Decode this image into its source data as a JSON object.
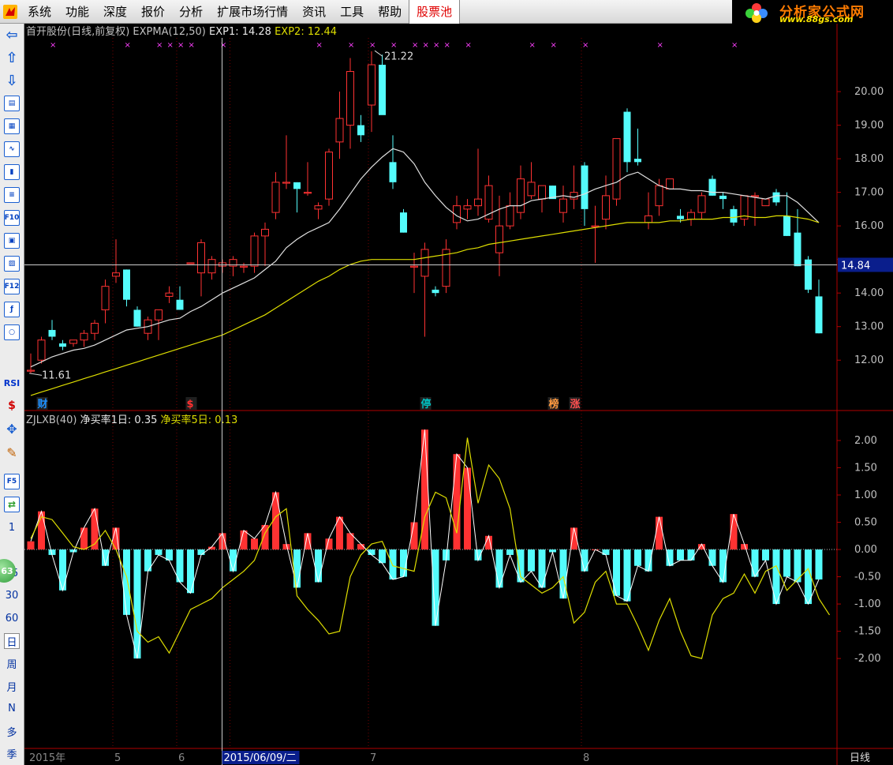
{
  "menu": {
    "items": [
      "系统",
      "功能",
      "深度",
      "报价",
      "分析",
      "扩展市场行情",
      "资讯",
      "工具",
      "帮助",
      "股票池"
    ],
    "highlight_index": 9
  },
  "brand": {
    "title": "分析家公式网",
    "url": "www.88gs.com"
  },
  "toolbar": {
    "icons": [
      "arrow-left-icon",
      "arrow-up-icon",
      "arrow-down-icon",
      "quote-list-icon",
      "grid-icon",
      "line-chart-icon",
      "candle-icon",
      "table-icon",
      "f10-icon",
      "report-icon",
      "finance-icon",
      "f12-icon",
      "formula-icon",
      "refresh-circle-icon"
    ],
    "labels": [
      "RSI",
      "$"
    ],
    "periods": [
      "1",
      "15",
      "30",
      "60",
      "日",
      "周",
      "月",
      "N",
      "多",
      "季"
    ],
    "badge": "63",
    "extra_buttons": [
      "F5"
    ]
  },
  "main_panel": {
    "stock": "首开股份(日线,前复权)",
    "indicator": "EXPMA(12,50)",
    "exp1_label": "EXP1:",
    "exp1_value": "14.28",
    "exp2_label": "EXP2:",
    "exp2_value": "12.44",
    "y_ticks": [
      20,
      19,
      18,
      17,
      16,
      15,
      14,
      13,
      12
    ],
    "y_tick_labels": [
      "20.00",
      "19.00",
      "18.00",
      "17.00",
      "16.00",
      "",
      "14.00",
      "13.00",
      "12.00"
    ],
    "y_range": [
      10.9,
      21.6
    ],
    "crosshair_price": "14.84",
    "high_label": "21.22",
    "low_label": "11.61",
    "event_marks": [
      {
        "index": 1,
        "text": "财",
        "color": "#1e90ff"
      },
      {
        "index": 15,
        "text": "$",
        "color": "#ff3030"
      },
      {
        "index": 37,
        "text": "停",
        "color": "#00c0c0"
      },
      {
        "index": 49,
        "text": "榜",
        "color": "#ff9a40"
      },
      {
        "index": 51,
        "text": "涨",
        "color": "#ff5050"
      }
    ],
    "top_marks": [
      2,
      9,
      12,
      13,
      14,
      15,
      18,
      27,
      30,
      32,
      34,
      36,
      37,
      38,
      39,
      41,
      47,
      49,
      52,
      59,
      66
    ]
  },
  "sub_panel": {
    "indicator": "ZJLXB(40)",
    "line1_label": "净买率1日:",
    "line1_value": "0.35",
    "line2_label": "净买率5日:",
    "line2_value": "0.13",
    "y_ticks": [
      2,
      1.5,
      1,
      0.5,
      0,
      -0.5,
      -1,
      -1.5,
      -2
    ],
    "y_tick_labels": [
      "2.00",
      "1.50",
      "1.00",
      "0.50",
      "0.00",
      "-0.50",
      "-1.00",
      "-1.50",
      "-2.00"
    ],
    "y_range": [
      -3.65,
      2.55
    ]
  },
  "x_axis": {
    "labels": [
      {
        "index": 0,
        "text": "2015年"
      },
      {
        "index": 8,
        "text": "5"
      },
      {
        "index": 14,
        "text": "6"
      },
      {
        "index": 19,
        "text": "2015/06/09/二",
        "highlight": true
      },
      {
        "index": 32,
        "text": "7"
      },
      {
        "index": 52,
        "text": "8"
      }
    ],
    "period": "日线"
  },
  "crosshair_index": 18,
  "colors": {
    "up": "#ff3232",
    "down": "#54fcfc",
    "exp1": "#e0e0e0",
    "exp2": "#dede00",
    "axis": "#b00000",
    "text": "#c0c0c0"
  },
  "chart_data": {
    "type": "candlestick",
    "candles": [
      [
        11.7,
        11.6,
        12.2,
        11.7
      ],
      [
        12.0,
        11.9,
        12.7,
        12.6
      ],
      [
        12.9,
        12.6,
        13.2,
        12.7
      ],
      [
        12.5,
        12.3,
        12.6,
        12.4
      ],
      [
        12.5,
        12.4,
        12.6,
        12.6
      ],
      [
        12.6,
        12.4,
        12.9,
        12.8
      ],
      [
        12.8,
        12.6,
        13.2,
        13.1
      ],
      [
        13.5,
        13.1,
        14.4,
        14.2
      ],
      [
        14.5,
        14.3,
        15.6,
        14.6
      ],
      [
        14.7,
        13.6,
        14.7,
        13.8
      ],
      [
        13.5,
        13.0,
        13.6,
        13.0
      ],
      [
        12.8,
        12.6,
        13.3,
        13.2
      ],
      [
        13.2,
        12.6,
        13.3,
        13.5
      ],
      [
        13.9,
        13.7,
        14.2,
        14.0
      ],
      [
        13.8,
        13.5,
        14.2,
        13.5
      ],
      [
        14.9,
        14.9,
        14.9,
        14.9
      ],
      [
        14.6,
        13.9,
        15.6,
        15.5
      ],
      [
        14.6,
        14.4,
        15.1,
        15.0
      ],
      [
        14.8,
        14.6,
        15.0,
        14.9
      ],
      [
        14.8,
        14.5,
        15.1,
        15.0
      ],
      [
        14.8,
        14.6,
        14.9,
        14.8
      ],
      [
        14.8,
        14.6,
        15.8,
        15.7
      ],
      [
        15.7,
        14.8,
        16.1,
        15.9
      ],
      [
        16.4,
        16.2,
        17.6,
        17.3
      ],
      [
        17.3,
        17.1,
        18.7,
        17.3
      ],
      [
        17.3,
        16.4,
        17.3,
        17.1
      ],
      [
        17.0,
        16.9,
        17.9,
        17.0
      ],
      [
        16.5,
        16.2,
        16.7,
        16.6
      ],
      [
        16.8,
        16.6,
        18.3,
        18.2
      ],
      [
        18.5,
        18.0,
        20.0,
        19.2
      ],
      [
        19.0,
        18.3,
        21.0,
        20.6
      ],
      [
        19.0,
        18.5,
        19.3,
        18.7
      ],
      [
        19.6,
        18.8,
        21.2,
        20.8
      ],
      [
        20.8,
        19.8,
        21.1,
        19.3
      ],
      [
        17.9,
        17.1,
        18.7,
        17.3
      ],
      [
        16.4,
        15.8,
        16.5,
        15.8
      ],
      [
        14.8,
        14.0,
        15.2,
        14.8
      ],
      [
        14.5,
        12.7,
        15.5,
        15.3
      ],
      [
        14.1,
        13.9,
        14.2,
        14.0
      ],
      [
        14.2,
        14.0,
        15.6,
        15.3
      ],
      [
        16.1,
        15.9,
        16.9,
        16.6
      ],
      [
        16.5,
        16.2,
        16.8,
        16.6
      ],
      [
        16.6,
        16.3,
        18.3,
        16.8
      ],
      [
        16.2,
        16.1,
        17.5,
        17.2
      ],
      [
        15.2,
        14.5,
        16.9,
        16.0
      ],
      [
        16.0,
        15.9,
        17.0,
        16.6
      ],
      [
        16.4,
        16.2,
        17.8,
        17.4
      ],
      [
        16.9,
        16.8,
        17.9,
        17.3
      ],
      [
        16.8,
        16.4,
        17.0,
        17.2
      ],
      [
        17.2,
        17.0,
        17.2,
        16.8
      ],
      [
        16.4,
        16.1,
        17.2,
        16.8
      ],
      [
        16.8,
        16.5,
        17.8,
        17.0
      ],
      [
        17.8,
        16.0,
        17.9,
        16.5
      ],
      [
        16.0,
        14.9,
        16.6,
        16.0
      ],
      [
        16.2,
        15.9,
        17.5,
        16.9
      ],
      [
        16.8,
        16.6,
        18.5,
        18.6
      ],
      [
        19.4,
        17.6,
        19.5,
        17.9
      ],
      [
        18.0,
        17.8,
        18.9,
        17.9
      ],
      [
        16.1,
        15.9,
        17.0,
        16.3
      ],
      [
        16.6,
        16.3,
        17.4,
        17.2
      ],
      [
        17.1,
        17.1,
        17.1,
        17.4
      ],
      [
        16.3,
        16.1,
        16.5,
        16.2
      ],
      [
        16.2,
        16.0,
        16.5,
        16.4
      ],
      [
        16.4,
        16.2,
        17.0,
        16.9
      ],
      [
        17.4,
        16.9,
        17.5,
        16.9
      ],
      [
        16.9,
        16.5,
        17.0,
        16.8
      ],
      [
        16.5,
        16.0,
        16.6,
        16.1
      ],
      [
        16.2,
        16.0,
        16.9,
        16.9
      ],
      [
        16.9,
        16.0,
        17.0,
        16.9
      ],
      [
        16.6,
        16.6,
        16.8,
        16.8
      ],
      [
        17.0,
        16.6,
        17.1,
        16.7
      ],
      [
        16.3,
        15.7,
        17.0,
        15.7
      ],
      [
        15.8,
        14.8,
        16.5,
        14.8
      ],
      [
        15.0,
        14.0,
        15.1,
        14.1
      ],
      [
        13.9,
        12.8,
        14.4,
        12.8
      ]
    ],
    "exp1": [
      11.8,
      11.95,
      12.1,
      12.2,
      12.3,
      12.35,
      12.45,
      12.6,
      12.75,
      12.9,
      12.95,
      13.0,
      13.1,
      13.2,
      13.25,
      13.45,
      13.6,
      13.8,
      14.0,
      14.15,
      14.3,
      14.45,
      14.7,
      14.95,
      15.35,
      15.6,
      15.8,
      15.95,
      16.1,
      16.5,
      16.95,
      17.4,
      17.75,
      18.05,
      18.3,
      18.2,
      17.85,
      17.3,
      16.9,
      16.55,
      16.3,
      16.15,
      16.2,
      16.35,
      16.5,
      16.6,
      16.6,
      16.75,
      16.8,
      16.85,
      16.9,
      16.85,
      16.95,
      17.1,
      17.2,
      17.3,
      17.5,
      17.6,
      17.4,
      17.2,
      17.1,
      17.1,
      17.05,
      17.05,
      17.0,
      17.0,
      16.95,
      16.9,
      16.85,
      16.8,
      16.9,
      16.9,
      16.7,
      16.4,
      16.1
    ],
    "exp2": [
      10.95,
      11.05,
      11.15,
      11.25,
      11.35,
      11.45,
      11.55,
      11.65,
      11.75,
      11.85,
      11.95,
      12.05,
      12.15,
      12.25,
      12.35,
      12.45,
      12.55,
      12.65,
      12.75,
      12.9,
      13.05,
      13.2,
      13.35,
      13.55,
      13.75,
      13.95,
      14.15,
      14.35,
      14.5,
      14.7,
      14.85,
      14.95,
      15.0,
      15.0,
      15.0,
      15.0,
      15.0,
      15.05,
      15.1,
      15.15,
      15.2,
      15.3,
      15.35,
      15.45,
      15.5,
      15.55,
      15.6,
      15.65,
      15.7,
      15.75,
      15.8,
      15.85,
      15.9,
      15.95,
      16.0,
      16.05,
      16.1,
      16.1,
      16.1,
      16.1,
      16.15,
      16.15,
      16.2,
      16.2,
      16.2,
      16.25,
      16.25,
      16.3,
      16.25,
      16.25,
      16.3,
      16.3,
      16.25,
      16.2,
      16.1
    ],
    "net_1d": [
      0.15,
      0.7,
      -0.1,
      -0.75,
      -0.05,
      0.4,
      0.75,
      -0.3,
      0.4,
      -1.2,
      -2.0,
      -0.4,
      -0.1,
      -0.2,
      -0.6,
      -0.8,
      -0.1,
      0.05,
      0.3,
      -0.4,
      0.35,
      0.2,
      0.45,
      1.05,
      0.1,
      -0.7,
      0.3,
      -0.6,
      0.2,
      0.6,
      0.3,
      0.1,
      -0.1,
      -0.25,
      -0.55,
      -0.5,
      0.5,
      2.2,
      -1.4,
      -0.2,
      1.75,
      1.5,
      -0.2,
      0.25,
      -0.7,
      -0.1,
      -0.6,
      -0.4,
      -0.7,
      -0.05,
      -0.9,
      0.4,
      -0.4,
      0.0,
      -0.1,
      -0.85,
      -0.95,
      -0.3,
      -0.4,
      0.6,
      -0.3,
      -0.2,
      -0.2,
      0.1,
      -0.3,
      -0.6,
      0.65,
      0.1,
      -0.5,
      -0.2,
      -1.0,
      -0.5,
      -0.6,
      -1.0,
      -0.55
    ],
    "net_5d": [
      0.2,
      0.6,
      0.55,
      0.3,
      0.05,
      0.0,
      0.1,
      0.35,
      0.0,
      -0.5,
      -1.5,
      -1.7,
      -1.6,
      -1.9,
      -1.5,
      -1.1,
      -1.0,
      -0.9,
      -0.7,
      -0.55,
      -0.4,
      -0.2,
      0.3,
      0.6,
      0.75,
      -0.85,
      -1.1,
      -1.3,
      -1.55,
      -1.5,
      -0.5,
      -0.1,
      0.1,
      0.15,
      -0.3,
      -0.35,
      -0.4,
      0.6,
      1.05,
      0.95,
      0.3,
      2.05,
      0.85,
      1.55,
      1.3,
      0.75,
      -0.5,
      -0.65,
      -0.8,
      -0.7,
      -0.5,
      -1.35,
      -1.15,
      -0.6,
      -0.4,
      -1.0,
      -1.0,
      -1.4,
      -1.85,
      -1.3,
      -0.9,
      -1.5,
      -1.95,
      -2.0,
      -1.2,
      -0.9,
      -0.8,
      -0.45,
      -0.8,
      -0.4,
      -0.3,
      -0.75,
      -0.55,
      -0.35,
      -0.9,
      -1.2
    ]
  }
}
